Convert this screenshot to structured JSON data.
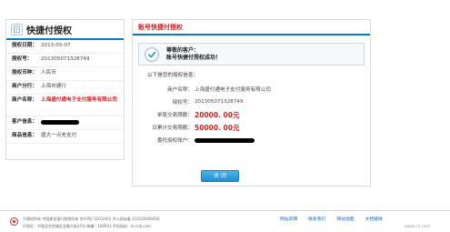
{
  "left": {
    "title": "快捷付授权",
    "rows": [
      {
        "label": "授权日期：",
        "value": "2013-05-07"
      },
      {
        "label": "授权号：",
        "value": "20130507132874​9"
      },
      {
        "label": "授权币种：",
        "value": "人民币"
      },
      {
        "label": "商户分行：",
        "value": "上海市建行"
      },
      {
        "label": "商户名称：",
        "value": "上海盛付通电子支付服务有限公司"
      },
      {
        "label": "客户信息：",
        "value": ""
      },
      {
        "label": "商品信息：",
        "value": "盛大一点充支付"
      }
    ]
  },
  "right": {
    "title": "账号快捷付授权",
    "success_line1": "尊敬的客户：",
    "success_line2": "账号快捷付授权成功！",
    "section_title": "以下是您的授权信息：",
    "details": [
      {
        "label": "商户名称：",
        "value": "上海盛付通电子支付服务有限公司"
      },
      {
        "label": "授权号：",
        "value": "201305071328749"
      },
      {
        "label": "单笔交易限额：",
        "value": "20000. 00元"
      },
      {
        "label": "日累计交易限额：",
        "value": "50000. 00元"
      },
      {
        "label": "委托授权账户：",
        "value": ""
      }
    ],
    "close_label": "关 闭"
  },
  "footer": {
    "line1": "©版权所有  中国建设银行版权所有  京ICP证 010104号  京公网安备 110102000450",
    "line2": "行地址：中国北京西城区金融大街25号    邮编：100033    手机网站：m.ccb.com",
    "links": [
      "网站声明",
      "联系我们",
      "网站地图",
      "文档链接"
    ],
    "watermark": "www.cn.com"
  },
  "colors": {
    "accent": "#0b7bc1",
    "highlight": "#cc1f1f",
    "button": "#1f8fd4"
  }
}
